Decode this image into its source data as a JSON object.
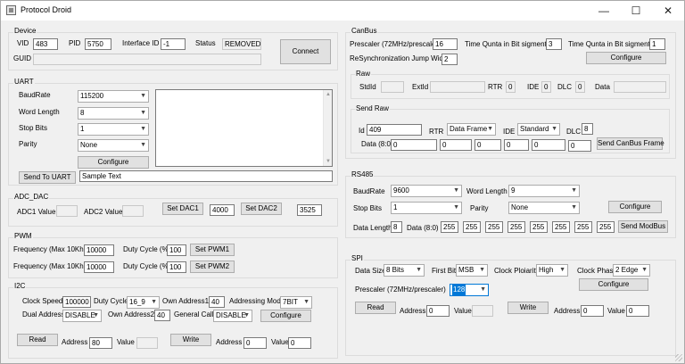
{
  "window": {
    "title": "Protocol Droid",
    "minimize": "—",
    "maximize": "☐",
    "close": "✕"
  },
  "device": {
    "group": "Device",
    "vid_label": "VID",
    "vid": "483",
    "pid_label": "PID",
    "pid": "5750",
    "iface_label": "Interface ID",
    "iface": "-1",
    "status_label": "Status",
    "status": "REMOVED",
    "guid_label": "GUID",
    "guid": "",
    "connect": "Connect"
  },
  "uart": {
    "group": "UART",
    "baud_label": "BaudRate",
    "baud": "115200",
    "wordlen_label": "Word Length",
    "wordlen": "8",
    "stop_label": "Stop Bits",
    "stop": "1",
    "parity_label": "Parity",
    "parity": "None",
    "configure": "Configure",
    "send": "Send To UART",
    "send_text": "Sample Text"
  },
  "adc": {
    "group": "ADC_DAC",
    "adc1_label": "ADC1 Value:",
    "adc1": "",
    "adc2_label": "ADC2 Value:",
    "adc2": "",
    "setdac1": "Set DAC1",
    "dac1": "4000",
    "setdac2": "Set DAC2",
    "dac2": "3525"
  },
  "pwm": {
    "group": "PWM",
    "freq_label": "Frequency (Max 10Khz)",
    "duty_label": "Duty Cycle (%)",
    "freq1": "10000",
    "duty1": "100",
    "set1": "Set PWM1",
    "freq2": "10000",
    "duty2": "100",
    "set2": "Set PWM2"
  },
  "i2c": {
    "group": "I2C",
    "clock_label": "Clock Speed",
    "clock": "100000",
    "duty_label": "Duty Cycle",
    "duty": "16_9",
    "own1_label": "Own Address1",
    "own1": "40",
    "mode_label": "Addressing Mode",
    "mode": "7BIT",
    "dual_label": "Dual Address",
    "dual": "DISABLE",
    "own2_label": "Own Address2",
    "own2": "40",
    "gcall_label": "General Call",
    "gcall": "DISABLE",
    "configure": "Configure",
    "read": "Read",
    "read_addr_label": "Address",
    "read_addr": "80",
    "read_val_label": "Value",
    "read_val": "",
    "write": "Write",
    "write_addr_label": "Address",
    "write_addr": "0",
    "write_val_label": "Value",
    "write_val": "0"
  },
  "canbus": {
    "group": "CanBus",
    "prescaler_label": "Prescaler (72MHz/prescaler)",
    "prescaler": "16",
    "tq1_label": "Time Qunta in Bit sigment 1",
    "tq1": "3",
    "tq2_label": "Time Qunta in Bit sigment 2",
    "tq2": "1",
    "sjw_label": "ReSynchronization Jump Width",
    "sjw": "2",
    "configure": "Configure"
  },
  "raw": {
    "group": "Raw",
    "stdid_label": "StdId",
    "stdid": "",
    "extid_label": "ExtId",
    "extid": "",
    "rtr_label": "RTR",
    "rtr": "0",
    "ide_label": "IDE",
    "ide": "0",
    "dlc_label": "DLC",
    "dlc": "0",
    "data_label": "Data",
    "data": ""
  },
  "sendraw": {
    "group": "Send Raw",
    "id_label": "Id",
    "id": "409",
    "rtr_label": "RTR",
    "rtr": "Data Frame",
    "ide_label": "IDE",
    "ide": "Standard",
    "dlc_label": "DLC",
    "dlc": "8",
    "data_label": "Data (8:0)",
    "data": [
      "0",
      "0",
      "0",
      "0",
      "0",
      "0",
      "0",
      "0"
    ],
    "send": "Send CanBus Frame"
  },
  "rs485": {
    "group": "RS485",
    "baud_label": "BaudRate",
    "baud": "9600",
    "wordlen_label": "Word Length",
    "wordlen": "9",
    "stop_label": "Stop Bits",
    "stop": "1",
    "parity_label": "Parity",
    "parity": "None",
    "configure": "Configure",
    "datalen_label": "Data Length",
    "datalen": "8",
    "data_label": "Data (8:0)",
    "data": [
      "255",
      "255",
      "255",
      "255",
      "255",
      "255",
      "255",
      "255"
    ],
    "send": "Send ModBus"
  },
  "spi": {
    "group": "SPI",
    "datasize_label": "Data Size",
    "datasize": "8 Bits",
    "firstbit_label": "First Bit",
    "firstbit": "MSB",
    "cpol_label": "Clock Ploiarity",
    "cpol": "High",
    "cpha_label": "Clock Phase",
    "cpha": "2 Edge",
    "configure": "Configure",
    "prescaler_label": "Prescaler (72MHz/prescaler)",
    "prescaler": "128",
    "read": "Read",
    "read_addr_label": "Address",
    "read_addr": "0",
    "read_val_label": "Value",
    "read_val": "",
    "write": "Write",
    "write_addr_label": "Address",
    "write_addr": "0",
    "write_val_label": "Value",
    "write_val": "0"
  }
}
